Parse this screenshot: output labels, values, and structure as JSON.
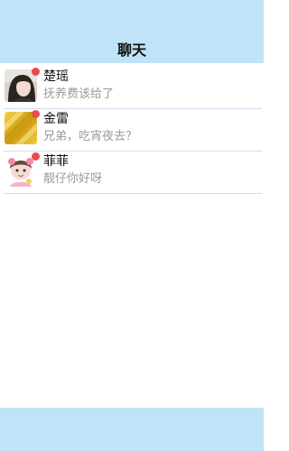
{
  "header": {
    "title": "聊天"
  },
  "chats": [
    {
      "name": "楚瑶",
      "message": "抚养费该给了",
      "avatar_icon": "woman-portrait-icon"
    },
    {
      "name": "金雷",
      "message": "兄弟，吃宵夜去？",
      "avatar_icon": "gold-texture-icon"
    },
    {
      "name": "菲菲",
      "message": "靓仔你好呀",
      "avatar_icon": "girl-portrait-icon"
    }
  ],
  "colors": {
    "header_bg": "#bfe3f7",
    "footer_bg": "#bfe3f7",
    "badge": "#e84c4c"
  }
}
